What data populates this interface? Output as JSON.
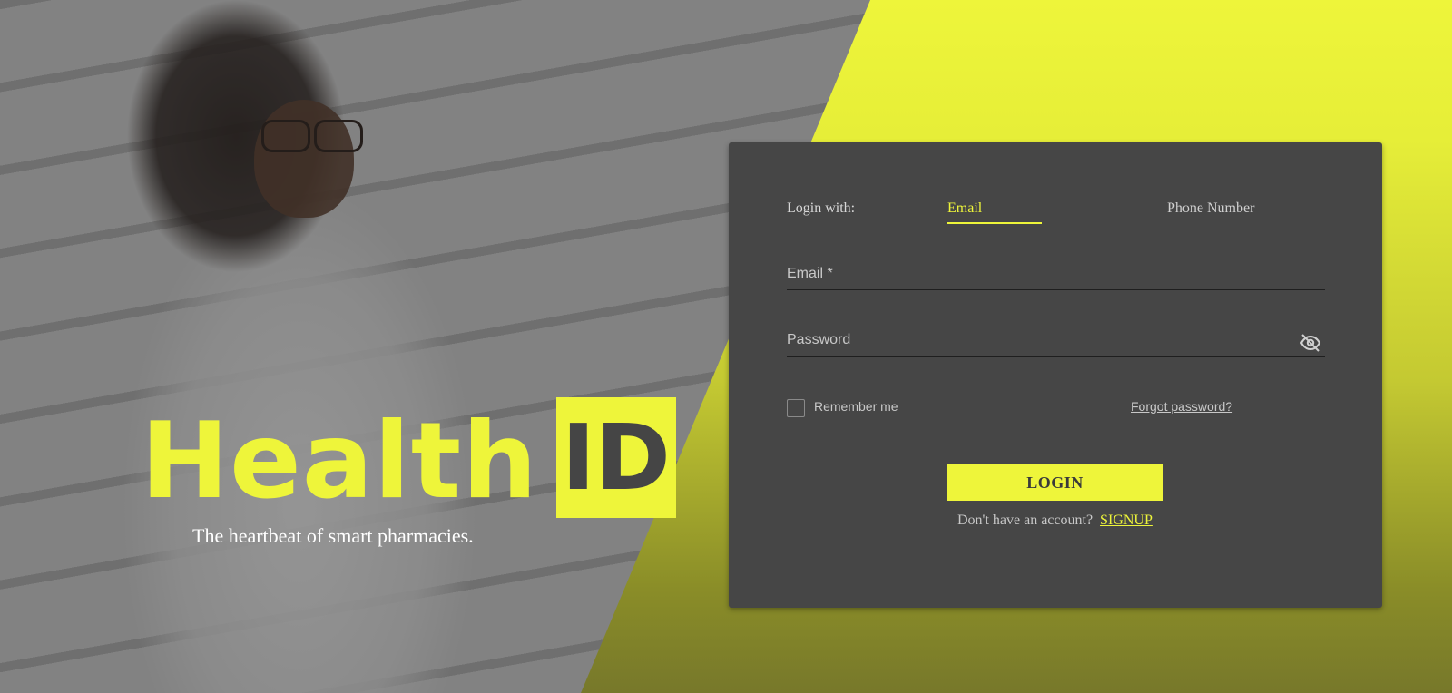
{
  "brand": {
    "logo_text": "Health",
    "logo_badge": "ID",
    "tagline": "The heartbeat of smart pharmacies."
  },
  "login": {
    "login_with_label": "Login with:",
    "tabs": [
      {
        "label": "Email",
        "active": true
      },
      {
        "label": "Phone Number",
        "active": false
      }
    ],
    "email_label": "Email *",
    "password_label": "Password",
    "remember_label": "Remember me",
    "remember_checked": false,
    "forgot_label": "Forgot password?",
    "login_button": "LOGIN",
    "no_account_text": "Don't have an account?",
    "signup_label": "SIGNUP"
  },
  "colors": {
    "accent": "#eef53a",
    "card": "#464646",
    "logo_badge_text": "#454545"
  },
  "icons": {
    "password_toggle": "eye-off-icon"
  }
}
